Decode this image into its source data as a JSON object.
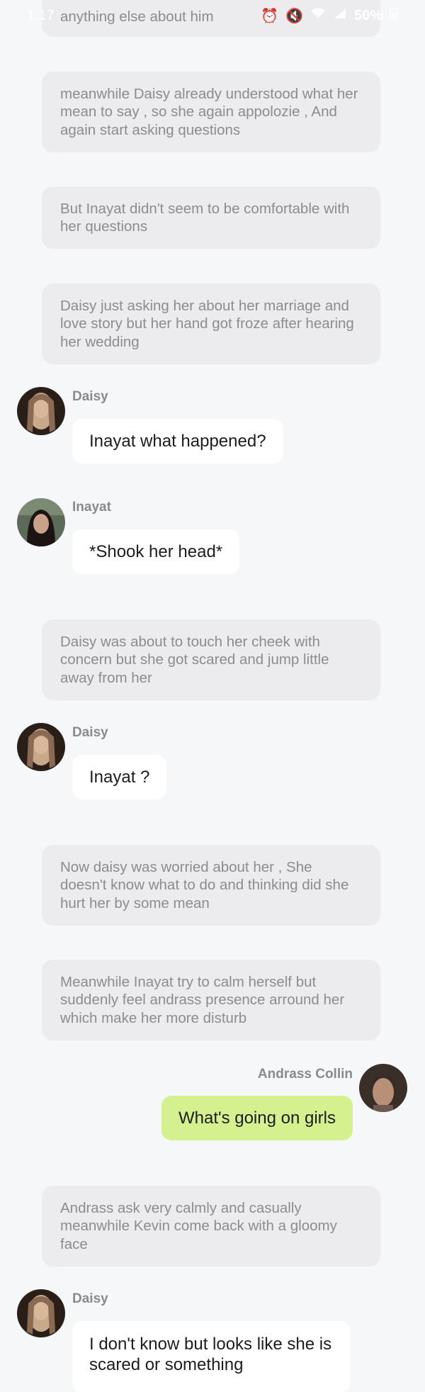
{
  "status_bar": {
    "time": "1:17",
    "battery": "50%"
  },
  "narrations": [
    "anything else about him",
    "meanwhile Daisy already understood what her mean to say , so she again appolozie , And again start asking questions",
    "But Inayat didn't seem to be comfortable with her questions",
    "Daisy just asking her about her marriage and love story but her hand got froze after hearing her wedding",
    "Daisy was about to touch her cheek with concern but she got scared and jump little away from her",
    "Now daisy was worried about her , She doesn't know what to do and thinking did she hurt her by some mean",
    "Meanwhile Inayat try to calm herself but suddenly feel andrass presence arround her which make her more disturb",
    "Andrass ask very calmly and casually meanwhile Kevin come back with a gloomy face"
  ],
  "messages": [
    {
      "sender": "Daisy",
      "text": "Inayat what happened?"
    },
    {
      "sender": "Inayat",
      "text": "*Shook her head*"
    },
    {
      "sender": "Daisy",
      "text": "Inayat ?"
    },
    {
      "sender": "Andrass Collin",
      "text": "What's going on girls"
    },
    {
      "sender": "Daisy",
      "text": "I don't know but looks like she is scared or something"
    }
  ],
  "colors": {
    "background": "#f6f7f9",
    "narration_bg": "#ececee",
    "bubble_bg": "#ffffff",
    "own_bubble_bg": "#d5f18f"
  }
}
